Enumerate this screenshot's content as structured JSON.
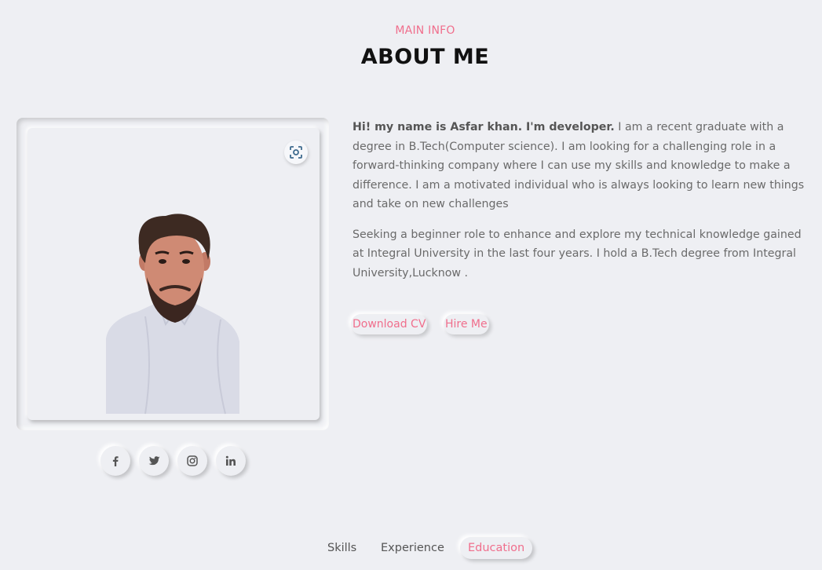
{
  "header": {
    "subtitle": "MAIN INFO",
    "title": "ABOUT ME"
  },
  "profile": {
    "photo_alt": "Profile photo",
    "lens_icon": "focus-lens-icon"
  },
  "bio": {
    "intro_bold": "Hi! my name is Asfar khan. I'm developer.",
    "intro_rest": " I am a recent graduate with a degree in B.Tech(Computer science). I am looking for a challenging role in a forward-thinking company where I can use my skills and knowledge to make a difference. I am a motivated individual who is always looking to learn new things and take on new challenges",
    "paragraph2": "Seeking a beginner role to enhance and explore my technical knowledge gained at Integral University in the last four years. I hold a B.Tech degree from Integral University,Lucknow ."
  },
  "actions": {
    "download_cv": "Download CV",
    "hire_me": "Hire Me"
  },
  "social": {
    "items": [
      {
        "icon": "facebook-icon"
      },
      {
        "icon": "twitter-icon"
      },
      {
        "icon": "instagram-icon"
      },
      {
        "icon": "linkedin-icon"
      }
    ]
  },
  "tabs": {
    "skills": "Skills",
    "experience": "Experience",
    "education": "Education",
    "active": "Education"
  },
  "colors": {
    "accent": "#f06e8c",
    "background": "#eeeff3"
  }
}
